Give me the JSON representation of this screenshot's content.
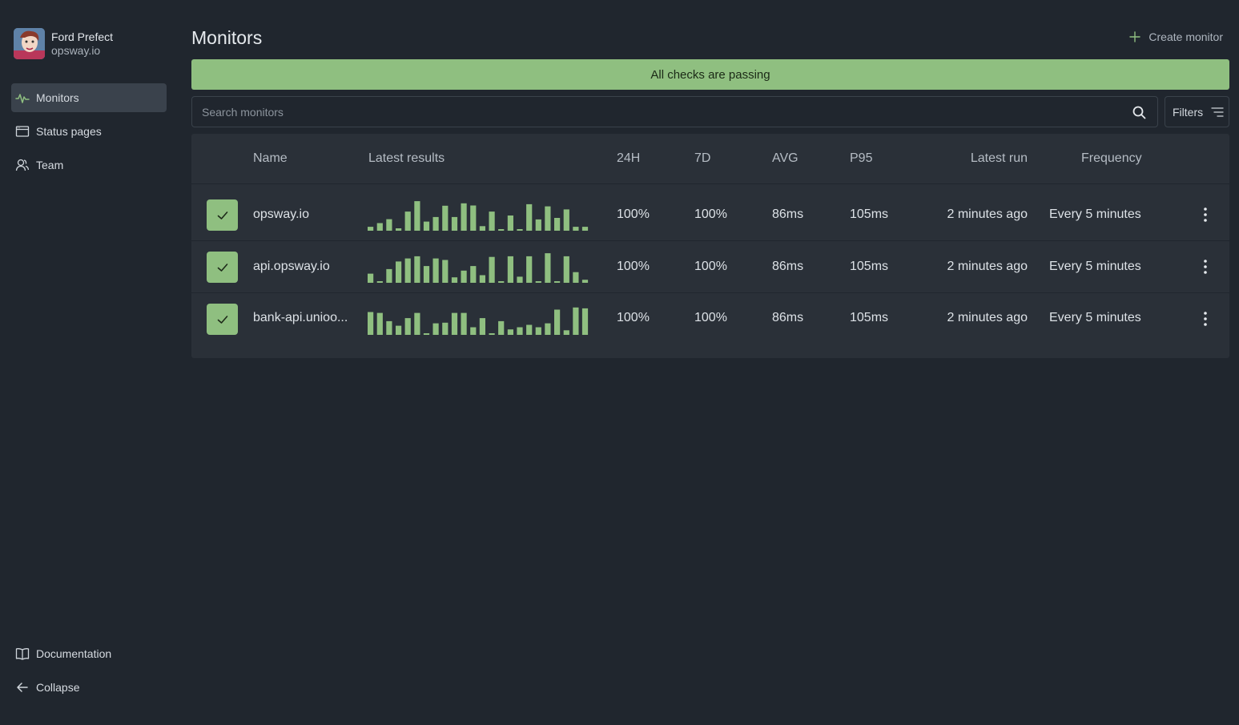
{
  "profile": {
    "name": "Ford Prefect",
    "org": "opsway.io"
  },
  "nav": {
    "items": [
      {
        "label": "Monitors",
        "icon": "pulse-icon",
        "active": true
      },
      {
        "label": "Status pages",
        "icon": "browser-window-icon",
        "active": false
      },
      {
        "label": "Team",
        "icon": "users-icon",
        "active": false
      }
    ],
    "bottom": [
      {
        "label": "Documentation",
        "icon": "book-icon"
      },
      {
        "label": "Collapse",
        "icon": "arrow-left-icon"
      }
    ]
  },
  "header": {
    "title": "Monitors",
    "create_label": "Create monitor"
  },
  "banner": {
    "text": "All checks are passing",
    "color": "#8fbf80"
  },
  "search": {
    "placeholder": "Search monitors",
    "value": ""
  },
  "filters": {
    "label": "Filters"
  },
  "table": {
    "columns": [
      "Name",
      "Latest results",
      "24H",
      "7D",
      "AVG",
      "P95",
      "Latest run",
      "Frequency"
    ],
    "rows": [
      {
        "status": "passing",
        "name": "opsway.io",
        "uptime_24h": "100%",
        "uptime_7d": "100%",
        "avg": "86ms",
        "p95": "105ms",
        "latest_run": "2 minutes ago",
        "frequency": "Every 5 minutes",
        "results": [
          0.13,
          0.25,
          0.38,
          0.08,
          0.63,
          0.97,
          0.3,
          0.45,
          0.82,
          0.45,
          0.9,
          0.83,
          0.15,
          0.63,
          0.03,
          0.5,
          0.03,
          0.87,
          0.37,
          0.8,
          0.42,
          0.7,
          0.13,
          0.13
        ]
      },
      {
        "status": "passing",
        "name": "api.opsway.io",
        "uptime_24h": "100%",
        "uptime_7d": "100%",
        "avg": "86ms",
        "p95": "105ms",
        "latest_run": "2 minutes ago",
        "frequency": "Every 5 minutes",
        "results": [
          0.3,
          0.05,
          0.45,
          0.7,
          0.8,
          0.87,
          0.55,
          0.8,
          0.75,
          0.18,
          0.4,
          0.55,
          0.25,
          0.85,
          0.03,
          0.87,
          0.2,
          0.87,
          0.05,
          0.97,
          0.03,
          0.87,
          0.35,
          0.1
        ]
      },
      {
        "status": "passing",
        "name": "bank-api.unioo...",
        "uptime_24h": "100%",
        "uptime_7d": "100%",
        "avg": "86ms",
        "p95": "105ms",
        "latest_run": "2 minutes ago",
        "frequency": "Every 5 minutes",
        "results": [
          0.75,
          0.72,
          0.45,
          0.3,
          0.55,
          0.72,
          0.05,
          0.38,
          0.4,
          0.72,
          0.72,
          0.25,
          0.55,
          0.05,
          0.45,
          0.18,
          0.25,
          0.33,
          0.25,
          0.38,
          0.83,
          0.15,
          0.9,
          0.87
        ]
      }
    ]
  }
}
